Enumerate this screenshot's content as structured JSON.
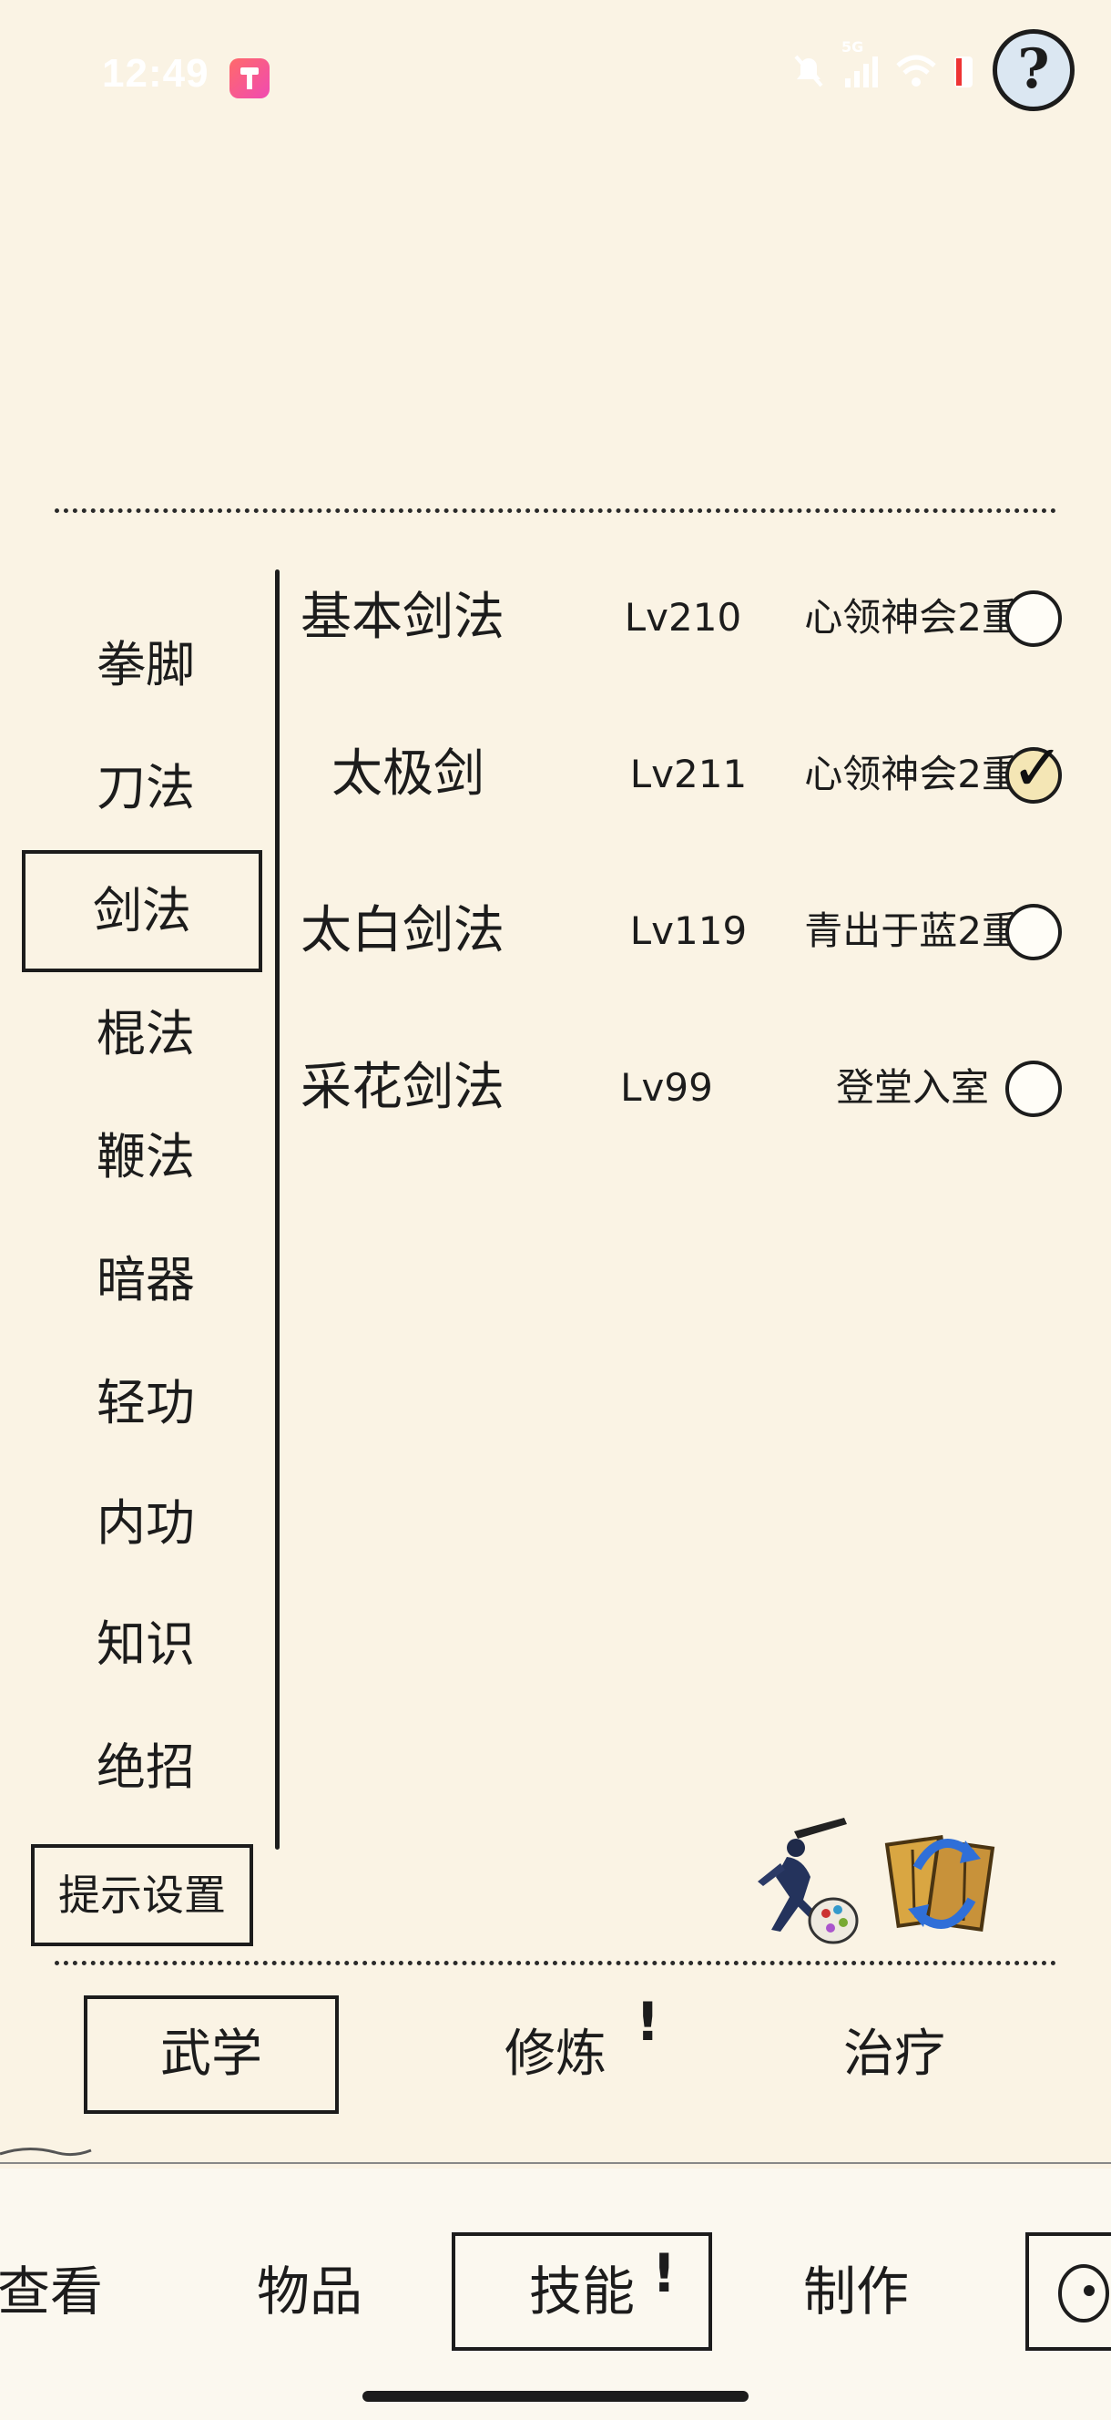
{
  "status_bar": {
    "time": "12:49",
    "icons": [
      "app-notification-icon",
      "mute-icon",
      "signal-5g-icon",
      "wifi-icon",
      "battery-icon"
    ],
    "network_label": "5G"
  },
  "help_button": {
    "label": "?"
  },
  "categories": [
    {
      "label": "拳脚"
    },
    {
      "label": "刀法"
    },
    {
      "label": "剑法",
      "active": true
    },
    {
      "label": "棍法"
    },
    {
      "label": "鞭法"
    },
    {
      "label": "暗器"
    },
    {
      "label": "轻功"
    },
    {
      "label": "内功"
    },
    {
      "label": "知识"
    },
    {
      "label": "绝招"
    }
  ],
  "skills": [
    {
      "name": "基本剑法",
      "level": "Lv210",
      "realm": "心领神会2重",
      "checked": false
    },
    {
      "name": "太极剑",
      "level": "Lv211",
      "realm": "心领神会2重",
      "checked": true
    },
    {
      "name": "太白剑法",
      "level": "Lv119",
      "realm": "青出于蓝2重",
      "checked": false
    },
    {
      "name": "采花剑法",
      "level": "Lv99",
      "realm": "登堂入室",
      "checked": false
    }
  ],
  "hint_settings_label": "提示设置",
  "icons": {
    "swordsman": "swordsman-icon",
    "manual_swap": "manual-swap-icon"
  },
  "sub_tabs": [
    {
      "label": "武学",
      "active": true,
      "alert": false
    },
    {
      "label": "修炼",
      "active": false,
      "alert": true
    },
    {
      "label": "治疗",
      "active": false,
      "alert": false
    }
  ],
  "nav_tabs": [
    {
      "label": "查看"
    },
    {
      "label": "物品"
    },
    {
      "label": "技能",
      "active": true,
      "alert": true
    },
    {
      "label": "制作"
    }
  ],
  "colors": {
    "background": "#faf3e4",
    "ink": "#1c1c1c",
    "checked_fill": "#f4e6b5"
  }
}
